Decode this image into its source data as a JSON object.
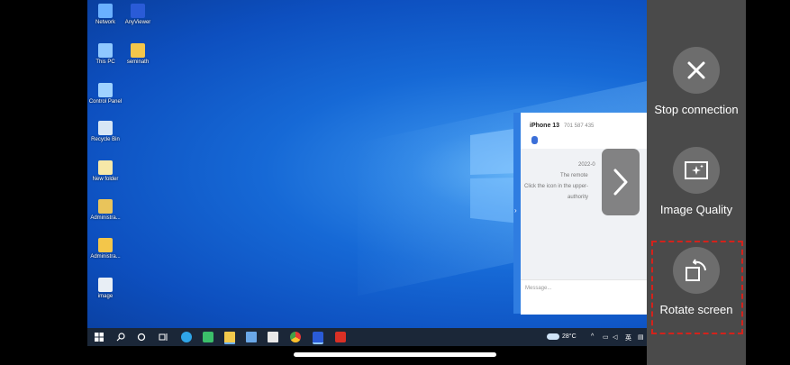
{
  "desktop": {
    "icons": [
      {
        "label": "Network",
        "icon": "network-icon"
      },
      {
        "label": "AnyViewer",
        "icon": "anyviewer-icon"
      },
      {
        "label": "This PC",
        "icon": "computer-icon"
      },
      {
        "label": "seminath",
        "icon": "file-icon"
      },
      {
        "label": "Control Panel",
        "icon": "control-panel-icon"
      },
      {
        "label": "Recycle Bin",
        "icon": "recycle-bin-icon"
      },
      {
        "label": "New folder",
        "icon": "folder-icon"
      },
      {
        "label": "Administra...",
        "icon": "user-folder-icon"
      },
      {
        "label": "Administra...",
        "icon": "folder-icon"
      },
      {
        "label": "image",
        "icon": "image-file-icon"
      }
    ]
  },
  "chat": {
    "device": "iPhone 13",
    "device_id": "701 587 435",
    "messages": [
      "2022-0",
      "The remote",
      "Click the icon in the upper-",
      "authority"
    ],
    "input_placeholder": "Message..."
  },
  "taskbar": {
    "weather": "28°C",
    "lang": "英"
  },
  "side_panel": {
    "actions": [
      {
        "label": "Stop connection",
        "icon": "close-icon"
      },
      {
        "label": "Image Quality",
        "icon": "image-quality-icon"
      },
      {
        "label": "Rotate screen",
        "icon": "rotate-screen-icon"
      }
    ],
    "highlight_color": "#d4221b"
  }
}
